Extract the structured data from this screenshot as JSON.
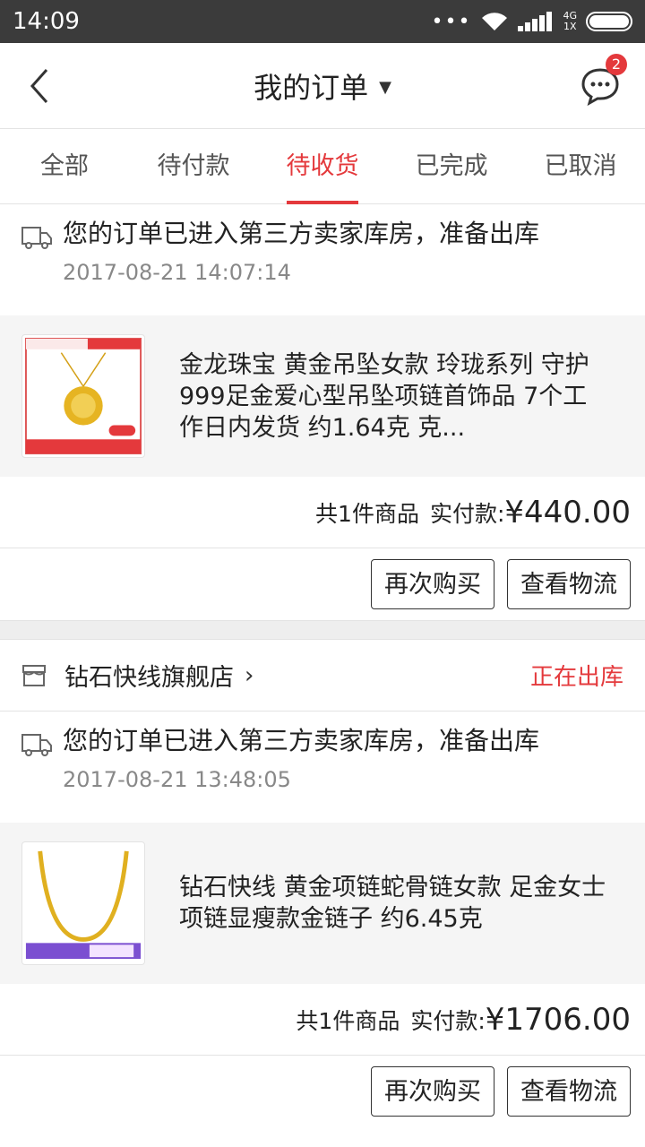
{
  "status_bar": {
    "time": "14:09",
    "network": "4G",
    "sim": "1X"
  },
  "header": {
    "title": "我的订单",
    "badge_count": "2"
  },
  "tabs": [
    {
      "label": "全部"
    },
    {
      "label": "待付款"
    },
    {
      "label": "待收货"
    },
    {
      "label": "已完成"
    },
    {
      "label": "已取消"
    }
  ],
  "active_tab": "待收货",
  "accent_color": "#e4393c",
  "orders": [
    {
      "logistics_text": "您的订单已进入第三方卖家库房，准备出库",
      "logistics_time": "2017-08-21 14:07:14",
      "product_name": "金龙珠宝 黄金吊坠女款 玲珑系列 守护 999足金爱心型吊坠项链首饰品 7个工作日内发货 约1.64克 克...",
      "item_count": "共1件商品",
      "paid_label": "实付款:",
      "price": "¥440.00",
      "rebuy": "再次购买",
      "track": "查看物流"
    },
    {
      "store_name": "钻石快线旗舰店",
      "store_status": "正在出库",
      "logistics_text": "您的订单已进入第三方卖家库房，准备出库",
      "logistics_time": "2017-08-21 13:48:05",
      "product_name": "钻石快线 黄金项链蛇骨链女款 足金女士项链显瘦款金链子 约6.45克",
      "item_count": "共1件商品",
      "paid_label": "实付款:",
      "price": "¥1706.00",
      "rebuy": "再次购买",
      "track": "查看物流"
    }
  ]
}
